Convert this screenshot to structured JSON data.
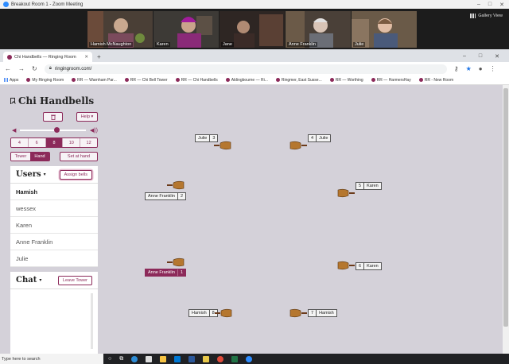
{
  "zoom": {
    "window_title": "Breakout Room 1 - Zoom Meeting",
    "gallery_view_label": "Gallery View",
    "participants": [
      "Hamish McNaughton",
      "Karen",
      "Jane",
      "Anne Franklin",
      "Julie"
    ]
  },
  "browser": {
    "tab_title": "Chi Handbells — Ringing Room",
    "url": "ringingroom.com/",
    "bookmarks": [
      "Apps",
      "My Ringing Room",
      "RR — Warnham Par...",
      "RR — Chi Bell Tower",
      "RR — Chi Handbells",
      "Aldingbourne — Ri...",
      "Ringmer, East Susse...",
      "RR — Worthing",
      "RR — HarmersHay",
      "RR - New Room"
    ]
  },
  "sidebar": {
    "title": "Chi Handbells",
    "help_label": "Help ▾",
    "tower_sizes": [
      "4",
      "6",
      "8",
      "10",
      "12"
    ],
    "selected_size": "8",
    "mode_tower": "Tower",
    "mode_hand": "Hand",
    "set_at_hand_label": "Set at hand",
    "volume_fraction": 0.55
  },
  "users": {
    "heading": "Users",
    "assign_label": "Assign bells",
    "list": [
      "Hamish",
      "wessex",
      "Karen",
      "Anne Franklin",
      "Julie"
    ]
  },
  "chat": {
    "heading": "Chat",
    "leave_label": "Leave Tower"
  },
  "bells": [
    {
      "number": "3",
      "name": "Julie"
    },
    {
      "number": "4",
      "name": "Julie"
    },
    {
      "number": "2",
      "name": "Anne Franklin"
    },
    {
      "number": "5",
      "name": "Karen"
    },
    {
      "number": "1",
      "name": "Anne Franklin"
    },
    {
      "number": "6",
      "name": "Karen"
    },
    {
      "number": "8",
      "name": "Hamish"
    },
    {
      "number": "7",
      "name": "Hamish"
    }
  ],
  "taskbar": {
    "search_placeholder": "Type here to search"
  },
  "colors": {
    "accent": "#8c2a5a",
    "page_bg": "#d4d1d9"
  }
}
